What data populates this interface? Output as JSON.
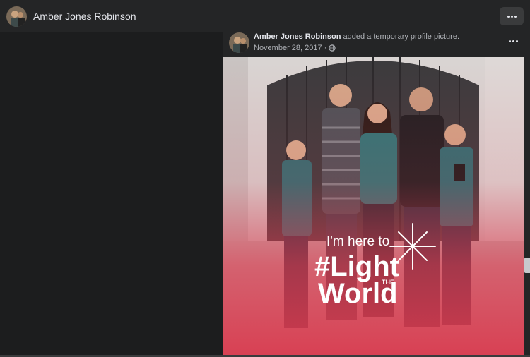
{
  "header": {
    "name": "Amber Jones Robinson",
    "more_icon": "more-horizontal-icon"
  },
  "post": {
    "author": "Amber Jones Robinson",
    "action": "added a temporary profile picture.",
    "date": "November 28, 2017",
    "separator": "·",
    "privacy_icon": "globe-icon",
    "more_icon": "more-horizontal-icon"
  },
  "photo": {
    "frame_line1": "I'm here to",
    "frame_hashtag": "#Light",
    "frame_small": "THE",
    "frame_line3": "World"
  },
  "colors": {
    "background": "#18191a",
    "surface": "#242526",
    "text_primary": "#e4e6eb",
    "text_secondary": "#b0b3b8",
    "frame_red": "#d93a4e"
  }
}
